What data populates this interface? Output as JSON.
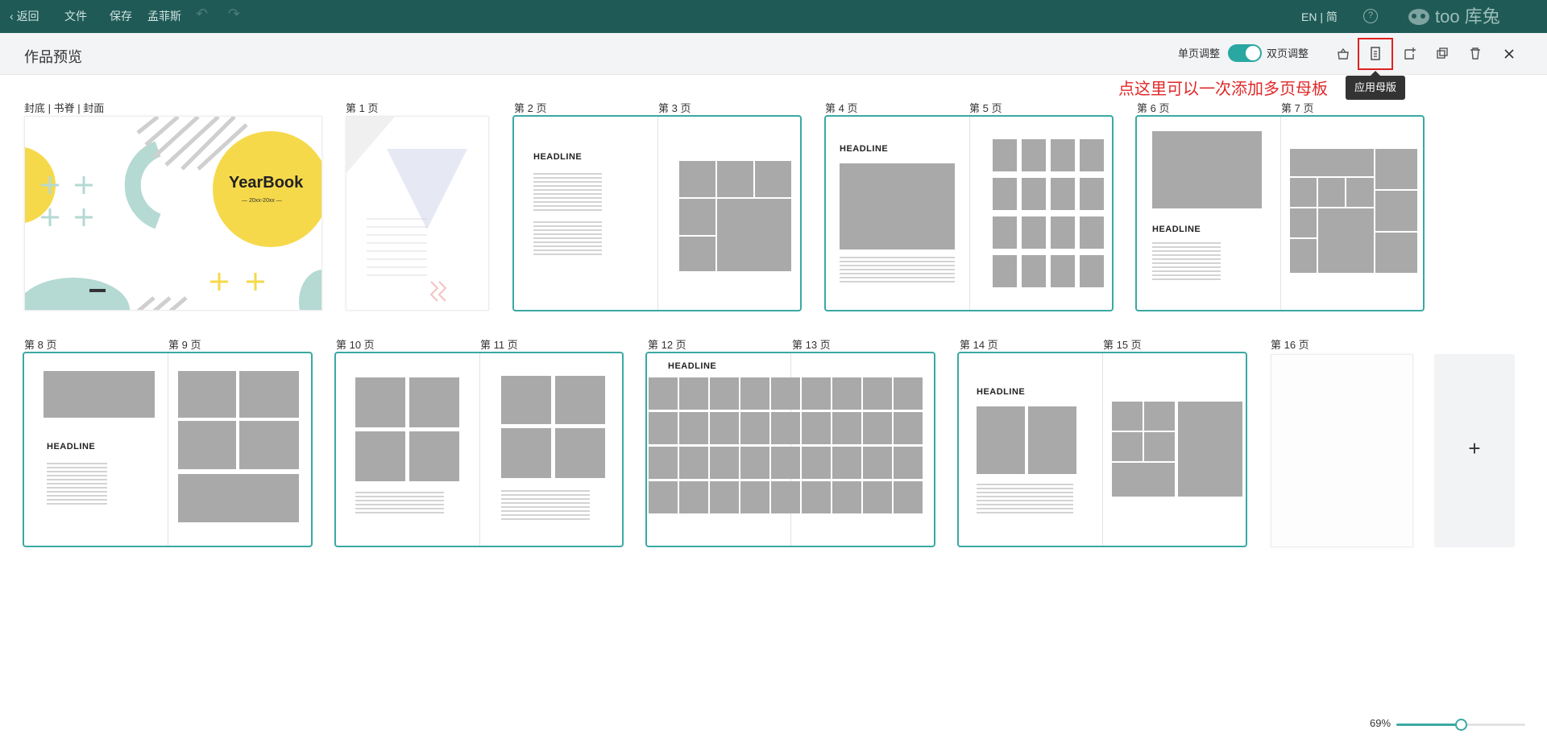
{
  "topbar": {
    "back": "返回",
    "file": "文件",
    "save": "保存",
    "user": "孟菲斯",
    "lang_en": "EN",
    "lang_sep": "|",
    "lang_cn": "简",
    "help": "?",
    "logo_text": "too 库兔"
  },
  "header": {
    "title": "作品预览",
    "single_label": "单页调整",
    "double_label": "双页调整",
    "tooltip": "应用母版",
    "annotation": "点这里可以一次添加多页母板"
  },
  "pages": {
    "cover": "封底 | 书脊 | 封面",
    "p1": "第 1 页",
    "p2": "第 2 页",
    "p3": "第 3 页",
    "p4": "第 4 页",
    "p5": "第 5 页",
    "p6": "第 6 页",
    "p7": "第 7 页",
    "p8": "第 8 页",
    "p9": "第 9 页",
    "p10": "第 10 页",
    "p11": "第 11 页",
    "p12": "第 12 页",
    "p13": "第 13 页",
    "p14": "第 14 页",
    "p15": "第 15 页",
    "p16": "第 16 页"
  },
  "content": {
    "cover_title": "YearBook",
    "cover_years": "— 20xx-20xx —",
    "headline": "HEADLINE"
  },
  "add_page": "+",
  "zoom": {
    "label": "69%",
    "value": 0.5
  },
  "colors": {
    "topbar": "#1f5a56",
    "accent": "#2aa7a1",
    "annotation": "#e02828",
    "cover_yellow": "#f5d94a"
  }
}
